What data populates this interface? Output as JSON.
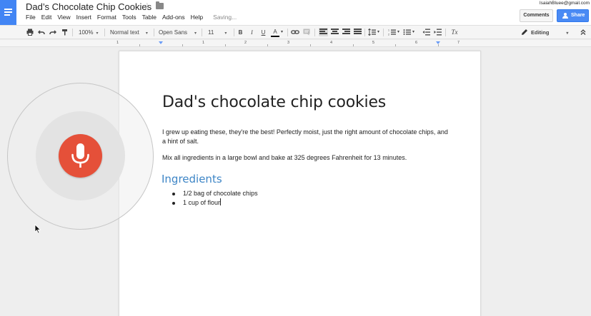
{
  "header": {
    "doc_title": "Dad’s Chocolate Chip Cookies",
    "menu": [
      "File",
      "Edit",
      "View",
      "Insert",
      "Format",
      "Tools",
      "Table",
      "Add-ons",
      "Help"
    ],
    "status": "Saving...",
    "user_email": "IsaiahBluee@gmail.com",
    "comments_label": "Comments",
    "share_label": "Share"
  },
  "toolbar": {
    "zoom": "100%",
    "style": "Normal text",
    "font": "Open Sans",
    "font_size": "11",
    "bold": "B",
    "italic": "I",
    "underline": "U",
    "text_color": "A",
    "clear_format": "Tx",
    "mode": "Editing"
  },
  "ruler": {
    "numbers": [
      "1",
      "1",
      "2",
      "3",
      "4",
      "5",
      "6",
      "7"
    ]
  },
  "document": {
    "title": "Dad's chocolate chip cookies",
    "paragraph1": "I grew up eating these, they're the best!  Perfectly moist, just the right amount of chocolate chips, and a hint of salt.",
    "paragraph2": "Mix all ingredients in a large bowl and bake at 325 degrees Fahrenheit for 13 minutes.",
    "heading": "Ingredients",
    "ingredients": [
      "1/2 bag of chocolate chips",
      "1 cup of flour"
    ]
  },
  "colors": {
    "docs_blue": "#4285f4",
    "share_blue": "#4a8af4",
    "heading_blue": "#3d85c6",
    "mic_red": "#e55039"
  }
}
